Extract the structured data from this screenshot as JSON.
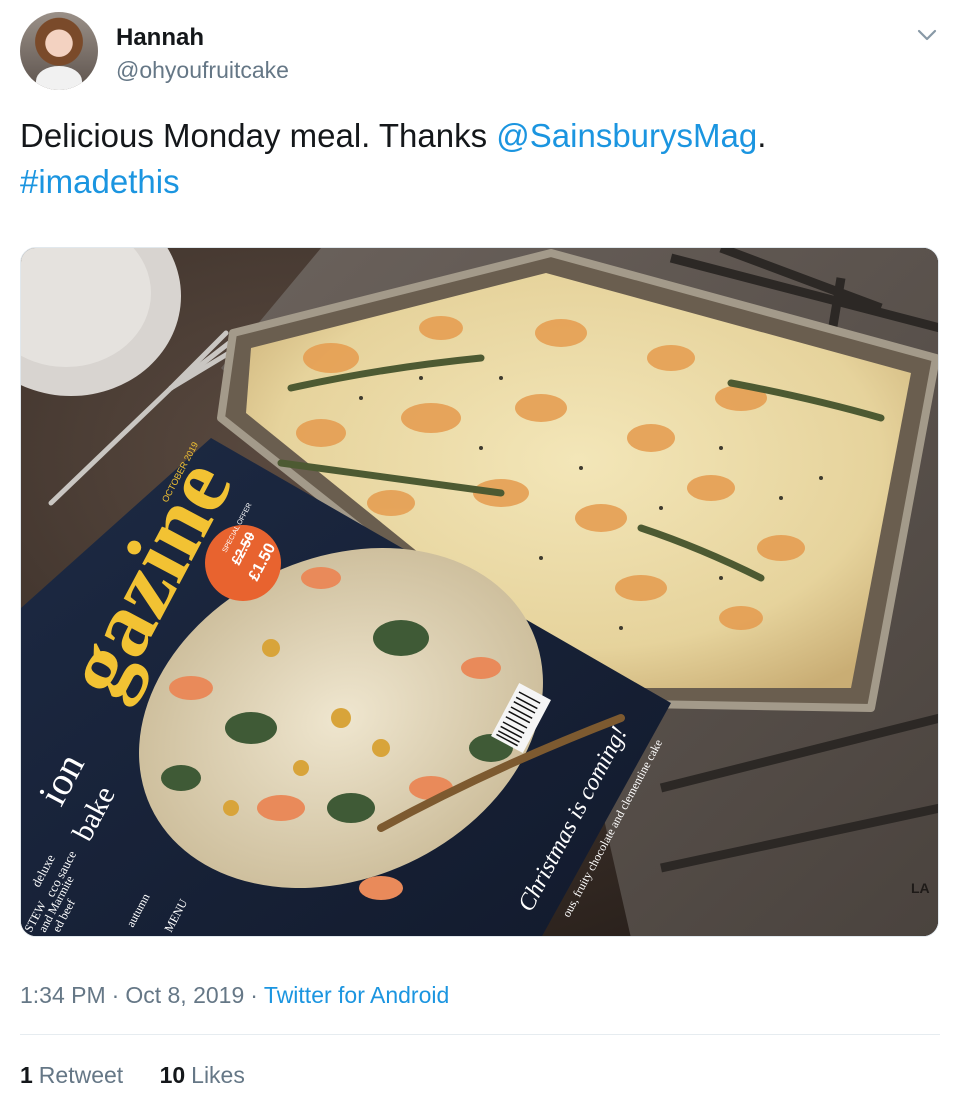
{
  "author": {
    "name": "Hannah",
    "handle": "@ohyoufruitcake"
  },
  "tweet": {
    "line1_text": "Delicious Monday meal. Thanks ",
    "line1_mention": "@SainsburysMag",
    "line1_end": ".",
    "hashtag": "#imadethis"
  },
  "media": {
    "magazine_title": "gazine",
    "cover_date": "OCTOBER 2019",
    "price_label": "SPECIAL OFFER",
    "price_old": "£2.50",
    "price_new": "£1.50",
    "headline": "Christmas is coming!",
    "subline": "ous, fruity chocolate and clementine cake",
    "side_text_1": "ion",
    "side_text_2": "bake",
    "side_text_3": "deluxe",
    "side_text_4": "cco sauce",
    "side_text_5": "STEW",
    "side_text_6": "and Marmite",
    "side_text_7": "ed beef",
    "side_text_8": "autumn",
    "side_text_9": "MENU",
    "oven_mark": "LA"
  },
  "meta": {
    "time": "1:34 PM",
    "date": "Oct 8, 2019",
    "source": "Twitter for Android"
  },
  "stats": {
    "retweets_count": "1",
    "retweets_label": "Retweet",
    "likes_count": "10",
    "likes_label": "Likes"
  },
  "colors": {
    "link": "#1b95e0",
    "secondary_text": "#657786",
    "primary_text": "#14171a"
  },
  "icons": {
    "caret": "chevron-down-icon"
  }
}
